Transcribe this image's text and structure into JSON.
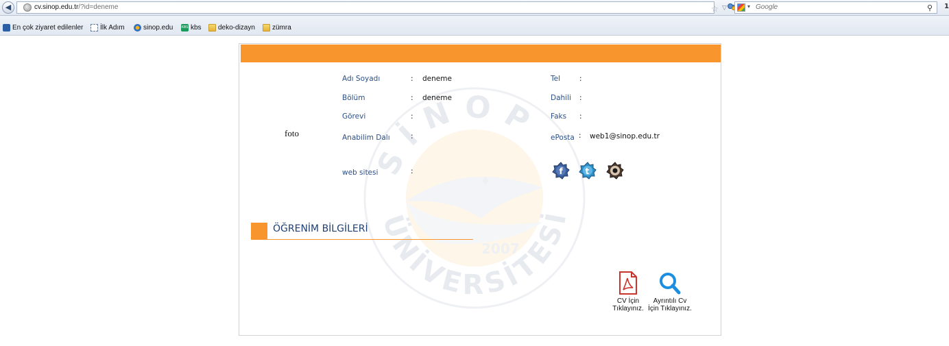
{
  "browser": {
    "address": {
      "host": "cv.sinop.edu.tr",
      "path": "/?id=deneme"
    },
    "search_placeholder": "Google",
    "bookmarks": [
      {
        "label": "En çok ziyaret edilenler",
        "icon": "most-visited-icon"
      },
      {
        "label": "İlk Adım",
        "icon": "dashed-page-icon"
      },
      {
        "label": "sinop.edu",
        "icon": "sinop-logo-icon"
      },
      {
        "label": "kbs",
        "icon": "kbs-icon"
      },
      {
        "label": "deko-dizayn",
        "icon": "folder-icon"
      },
      {
        "label": "zümra",
        "icon": "folder-icon"
      }
    ]
  },
  "profile": {
    "photo_label": "foto",
    "fields_left": [
      {
        "label": "Adı Soyadı",
        "sep": ":",
        "value": "deneme"
      },
      {
        "label": "Bölüm",
        "sep": ":",
        "value": "deneme"
      },
      {
        "label": "Görevi",
        "sep": ":",
        "value": ""
      },
      {
        "label": "Anabilim Dalı",
        "sep": ":",
        "value": ""
      },
      {
        "label": "web sitesi",
        "sep": ":",
        "value": ""
      }
    ],
    "fields_right": [
      {
        "label": "Tel",
        "sep": ":",
        "value": ""
      },
      {
        "label": "Dahili",
        "sep": ":",
        "value": ""
      },
      {
        "label": "Faks",
        "sep": ":",
        "value": ""
      },
      {
        "label": "ePosta",
        "sep": ":",
        "value": "web1@sinop.edu.tr"
      }
    ],
    "social_icons": [
      "facebook-icon",
      "twitter-icon",
      "camera-eye-icon"
    ]
  },
  "section": {
    "title": "ÖĞRENİM BİLGİLERİ"
  },
  "watermark": {
    "ring_text": "SİNOP ÜNİVERSİTESİ",
    "year": "2007"
  },
  "downloads": {
    "pdf": {
      "line1": "CV İçin",
      "line2": "Tıklayınız."
    },
    "detail": {
      "line1": "Ayrıntılı Cv",
      "line2": "İçin Tıklayınız."
    }
  },
  "colors": {
    "accent": "#f8952d",
    "label": "#2b4f86",
    "title": "#1f3f73"
  }
}
